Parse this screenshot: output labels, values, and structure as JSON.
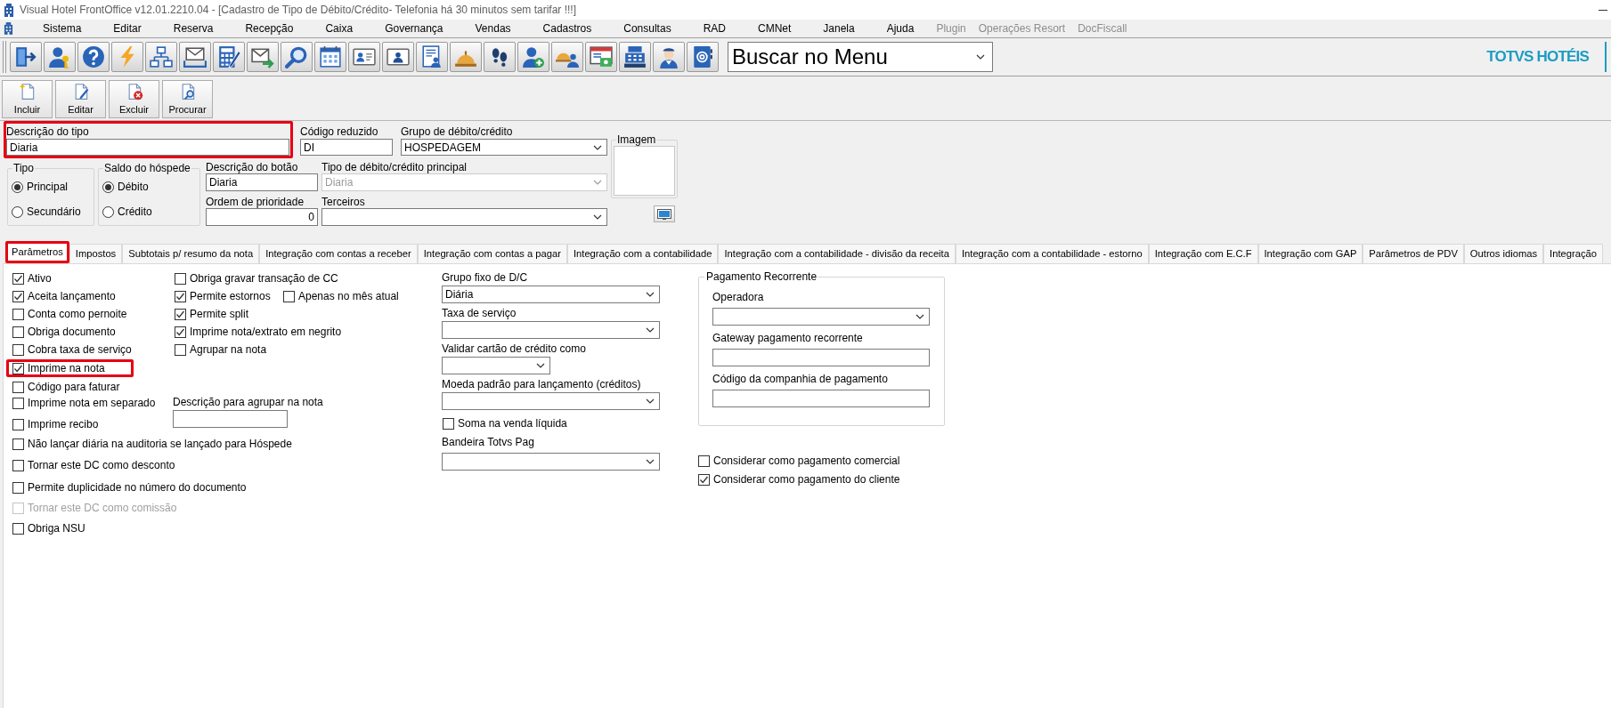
{
  "window": {
    "title": "Visual Hotel FrontOffice v12.01.2210.04 - [Cadastro de Tipo de Débito/Crédito- Telefonia há 30 minutos sem tarifar !!!]"
  },
  "menu": [
    {
      "label": "Sistema",
      "disabled": false
    },
    {
      "label": "Editar",
      "disabled": false
    },
    {
      "label": "Reserva",
      "disabled": false
    },
    {
      "label": "Recepção",
      "disabled": false
    },
    {
      "label": "Caixa",
      "disabled": false
    },
    {
      "label": "Governança",
      "disabled": false
    },
    {
      "label": "Vendas",
      "disabled": false
    },
    {
      "label": "Cadastros",
      "disabled": false
    },
    {
      "label": "Consultas",
      "disabled": false
    },
    {
      "label": "RAD",
      "disabled": false
    },
    {
      "label": "CMNet",
      "disabled": false
    },
    {
      "label": "Janela",
      "disabled": false
    },
    {
      "label": "Ajuda",
      "disabled": false
    },
    {
      "label": "Plugin",
      "disabled": true
    },
    {
      "label": "Operações Resort",
      "disabled": true
    },
    {
      "label": "DocFiscall",
      "disabled": true
    }
  ],
  "toolbar": {
    "menu_search": {
      "value": "Buscar no Menu"
    },
    "brand": "TOTVS HOTÉIS"
  },
  "actions": [
    "Incluir",
    "Editar",
    "Excluir",
    "Procurar"
  ],
  "header_form": {
    "type_description": {
      "label": "Descrição do tipo",
      "value": "Diaria",
      "highlighted": true
    },
    "short_code": {
      "label": "Código reduzido",
      "value": "DI"
    },
    "group": {
      "label": "Grupo de débito/crédito",
      "value": "HOSPEDAGEM"
    },
    "image": {
      "title": "Imagem"
    },
    "type": {
      "title": "Tipo",
      "options": [
        {
          "label": "Principal",
          "selected": true
        },
        {
          "label": "Secundário",
          "selected": false
        }
      ]
    },
    "guest_balance": {
      "title": "Saldo do hóspede",
      "options": [
        {
          "label": "Débito",
          "selected": true
        },
        {
          "label": "Crédito",
          "selected": false
        }
      ]
    },
    "button_description": {
      "label": "Descrição do botão",
      "value": "Diaria"
    },
    "main_type": {
      "label": "Tipo de débito/crédito principal",
      "value": "Diaria",
      "disabled": true
    },
    "priority": {
      "label": "Ordem de prioridade",
      "value": "0"
    },
    "third_parties": {
      "label": "Terceiros"
    }
  },
  "tabs": [
    {
      "label": "Parâmetros",
      "selected": true,
      "highlighted": true
    },
    {
      "label": "Impostos",
      "selected": false,
      "highlighted": false
    },
    {
      "label": "Subtotais p/ resumo da nota",
      "selected": false,
      "highlighted": false
    },
    {
      "label": "Integração com contas a receber",
      "selected": false,
      "highlighted": false
    },
    {
      "label": "Integração com contas a pagar",
      "selected": false,
      "highlighted": false
    },
    {
      "label": "Integração com a contabilidade",
      "selected": false,
      "highlighted": false
    },
    {
      "label": "Integração com a contabilidade - divisão da receita",
      "selected": false,
      "highlighted": false
    },
    {
      "label": "Integração com a contabilidade - estorno",
      "selected": false,
      "highlighted": false
    },
    {
      "label": "Integração com E.C.F",
      "selected": false,
      "highlighted": false
    },
    {
      "label": "Integração com GAP",
      "selected": false,
      "highlighted": false
    },
    {
      "label": "Parâmetros de PDV",
      "selected": false,
      "highlighted": false
    },
    {
      "label": "Outros idiomas",
      "selected": false,
      "highlighted": false
    },
    {
      "label": "Integração",
      "selected": false,
      "highlighted": false
    }
  ],
  "parameters": {
    "left_options": [
      {
        "label": "Ativo",
        "checked": true,
        "disabled": false,
        "highlighted": false
      },
      {
        "label": "Aceita lançamento",
        "checked": true,
        "disabled": false,
        "highlighted": false
      },
      {
        "label": "Conta como pernoite",
        "checked": false,
        "disabled": false,
        "highlighted": false
      },
      {
        "label": "Obriga documento",
        "checked": false,
        "disabled": false,
        "highlighted": false
      },
      {
        "label": "Cobra taxa de serviço",
        "checked": false,
        "disabled": false,
        "highlighted": false
      },
      {
        "label": "Imprime na nota",
        "checked": true,
        "disabled": false,
        "highlighted": true
      },
      {
        "label": "Código para faturar",
        "checked": false,
        "disabled": false,
        "highlighted": false
      },
      {
        "label": "Imprime nota em separado",
        "checked": false,
        "disabled": false,
        "highlighted": false
      },
      {
        "label": "Imprime recibo",
        "checked": false,
        "disabled": false,
        "highlighted": false
      },
      {
        "label": "Não lançar diária na auditoria se lançado para Hóspede",
        "checked": false,
        "disabled": false,
        "highlighted": false
      },
      {
        "label": "Tornar este DC como desconto",
        "checked": false,
        "disabled": false,
        "highlighted": false
      },
      {
        "label": "Permite duplicidade no número do documento",
        "checked": false,
        "disabled": false,
        "highlighted": false
      },
      {
        "label": "Tornar este DC como comissão",
        "checked": false,
        "disabled": true,
        "highlighted": false
      },
      {
        "label": "Obriga NSU",
        "checked": false,
        "disabled": false,
        "highlighted": false
      }
    ],
    "middle_options": [
      {
        "label": "Obriga gravar transação de CC",
        "checked": false
      },
      {
        "label": "Permite estornos",
        "checked": true,
        "sub_option": {
          "label": "Apenas no mês atual",
          "checked": false
        }
      },
      {
        "label": "Permite split",
        "checked": true
      },
      {
        "label": "Imprime nota/extrato em negrito",
        "checked": true
      },
      {
        "label": "Agrupar na nota",
        "checked": false
      }
    ],
    "group_description": {
      "label": "Descrição para agrupar na nota"
    },
    "fields": [
      {
        "label": "Grupo fixo de D/C",
        "value": "Diária"
      },
      {
        "label": "Taxa de serviço"
      },
      {
        "label": "Validar cartão de crédito como"
      },
      {
        "label": "Moeda padrão para lançamento (créditos)"
      }
    ],
    "net_sale": {
      "label": "Soma na venda líquida",
      "checked": false
    },
    "card_brand": {
      "label": "Bandeira Totvs Pag"
    },
    "recurring_payment": {
      "title": "Pagamento Recorrente",
      "fields": [
        {
          "kind": "select",
          "label": "Operadora"
        },
        {
          "kind": "text",
          "label": "Gateway pagamento recorrente"
        },
        {
          "kind": "text",
          "label": "Código da companhia de pagamento"
        }
      ]
    },
    "payment_options": [
      {
        "label": "Considerar como pagamento comercial",
        "checked": false
      },
      {
        "label": "Considerar como pagamento do cliente",
        "checked": true
      }
    ]
  }
}
